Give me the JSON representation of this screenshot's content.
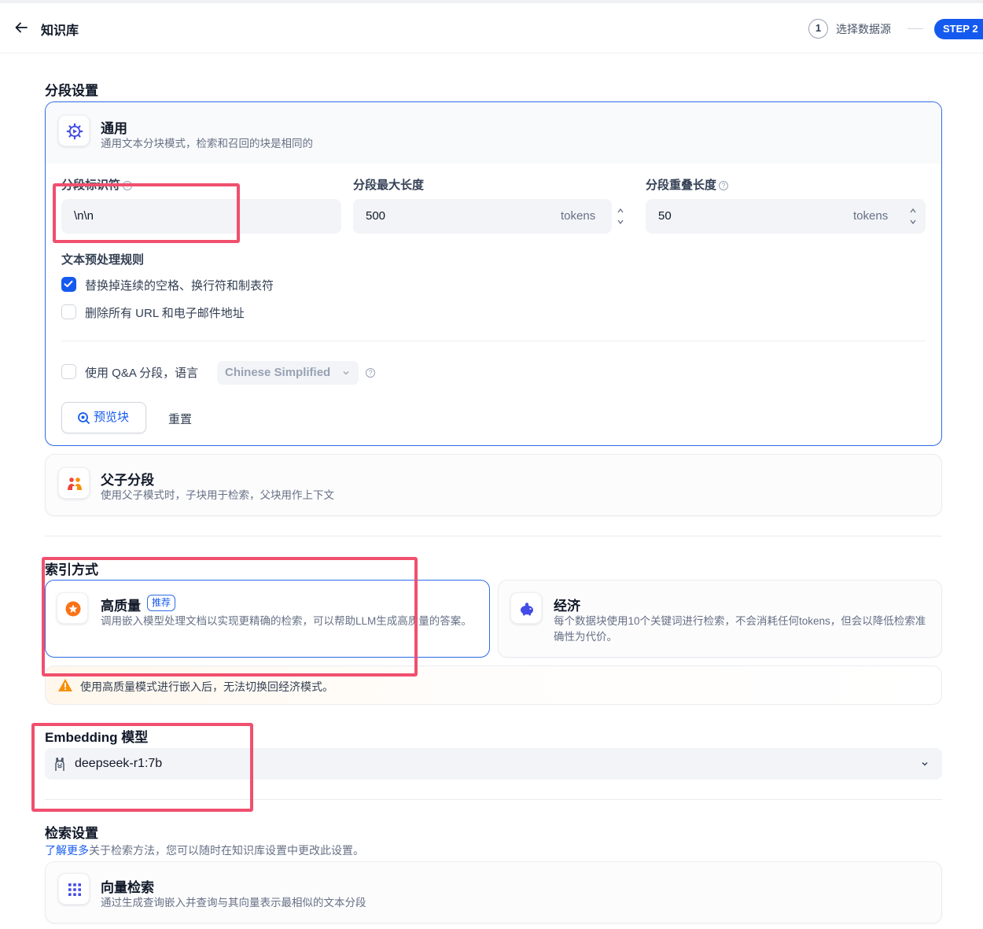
{
  "header": {
    "title": "知识库",
    "step_number": "1",
    "step_label": "选择数据源",
    "step_badge": "STEP 2"
  },
  "segmentation": {
    "section_title": "分段设置",
    "general": {
      "title": "通用",
      "description": "通用文本分块模式，检索和召回的块是相同的"
    },
    "fields": {
      "separator_label": "分段标识符",
      "separator_value": "\\n\\n",
      "max_length_label": "分段最大长度",
      "max_length_value": "500",
      "overlap_label": "分段重叠长度",
      "overlap_value": "50",
      "unit": "tokens"
    },
    "preprocess": {
      "title": "文本预处理规则",
      "rules": [
        {
          "label": "替换掉连续的空格、换行符和制表符",
          "checked": true
        },
        {
          "label": "删除所有 URL 和电子邮件地址",
          "checked": false
        }
      ]
    },
    "qa": {
      "label": "使用 Q&A 分段，语言",
      "language": "Chinese Simplified",
      "checked": false
    },
    "preview_button": "预览块",
    "reset_button": "重置",
    "parent_child": {
      "title": "父子分段",
      "description": "使用父子模式时，子块用于检索，父块用作上下文"
    }
  },
  "index": {
    "section_title": "索引方式",
    "high_quality": {
      "title": "高质量",
      "badge": "推荐",
      "description": "调用嵌入模型处理文档以实现更精确的检索，可以帮助LLM生成高质量的答案。"
    },
    "economy": {
      "title": "经济",
      "description": "每个数据块使用10个关键词进行检索，不会消耗任何tokens，但会以降低检索准确性为代价。"
    },
    "warning": "使用高质量模式进行嵌入后，无法切换回经济模式。"
  },
  "embedding": {
    "section_title": "Embedding 模型",
    "model": "deepseek-r1:7b"
  },
  "retrieval": {
    "section_title": "检索设置",
    "learn_more_link": "了解更多",
    "learn_more_text": "关于检索方法，您可以随时在知识库设置中更改此设置。",
    "vector": {
      "title": "向量检索",
      "description": "通过生成查询嵌入并查询与其向量表示最相似的文本分段"
    }
  },
  "colors": {
    "accent": "#155aef",
    "annotation": "#f0506e",
    "warning": "#f79009"
  }
}
